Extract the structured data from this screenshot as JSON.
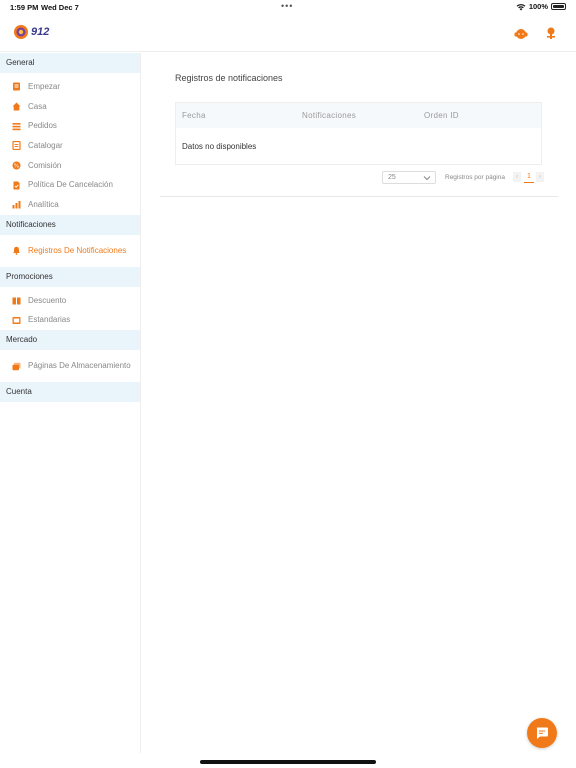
{
  "status": {
    "time": "1:59 PM",
    "date": "Wed Dec 7",
    "battery": "100%"
  },
  "app": {
    "logo_text": "912",
    "accent": "#f07a1a"
  },
  "sidebar": {
    "sections": [
      {
        "title": "General",
        "items": [
          {
            "label": "Empezar",
            "icon": "rocket-icon"
          },
          {
            "label": "Casa",
            "icon": "home-icon"
          },
          {
            "label": "Pedidos",
            "icon": "orders-icon"
          },
          {
            "label": "Catalogar",
            "icon": "catalog-icon"
          },
          {
            "label": "Comisión",
            "icon": "commission-icon"
          },
          {
            "label": "Política De Cancelación",
            "icon": "policy-icon"
          },
          {
            "label": "Analítica",
            "icon": "analytics-icon"
          }
        ]
      },
      {
        "title": "Notificaciones",
        "items": [
          {
            "label": "Registros De Notificaciones",
            "icon": "bell-icon",
            "active": true
          }
        ]
      },
      {
        "title": "Promociones",
        "items": [
          {
            "label": "Descuento",
            "icon": "discount-icon"
          },
          {
            "label": "Estandarias",
            "icon": "banner-icon"
          }
        ]
      },
      {
        "title": "Mercado",
        "items": [
          {
            "label": "Páginas De Almacenamiento",
            "icon": "store-icon"
          }
        ]
      },
      {
        "title": "Cuenta",
        "items": []
      }
    ]
  },
  "main": {
    "title": "Registros de notificaciones",
    "columns": [
      "Fecha",
      "Notificaciones",
      "Orden ID"
    ],
    "empty_text": "Datos no disponibles",
    "page_size": "25",
    "rows_per_page_label": "Registros por página",
    "current_page": "1"
  }
}
